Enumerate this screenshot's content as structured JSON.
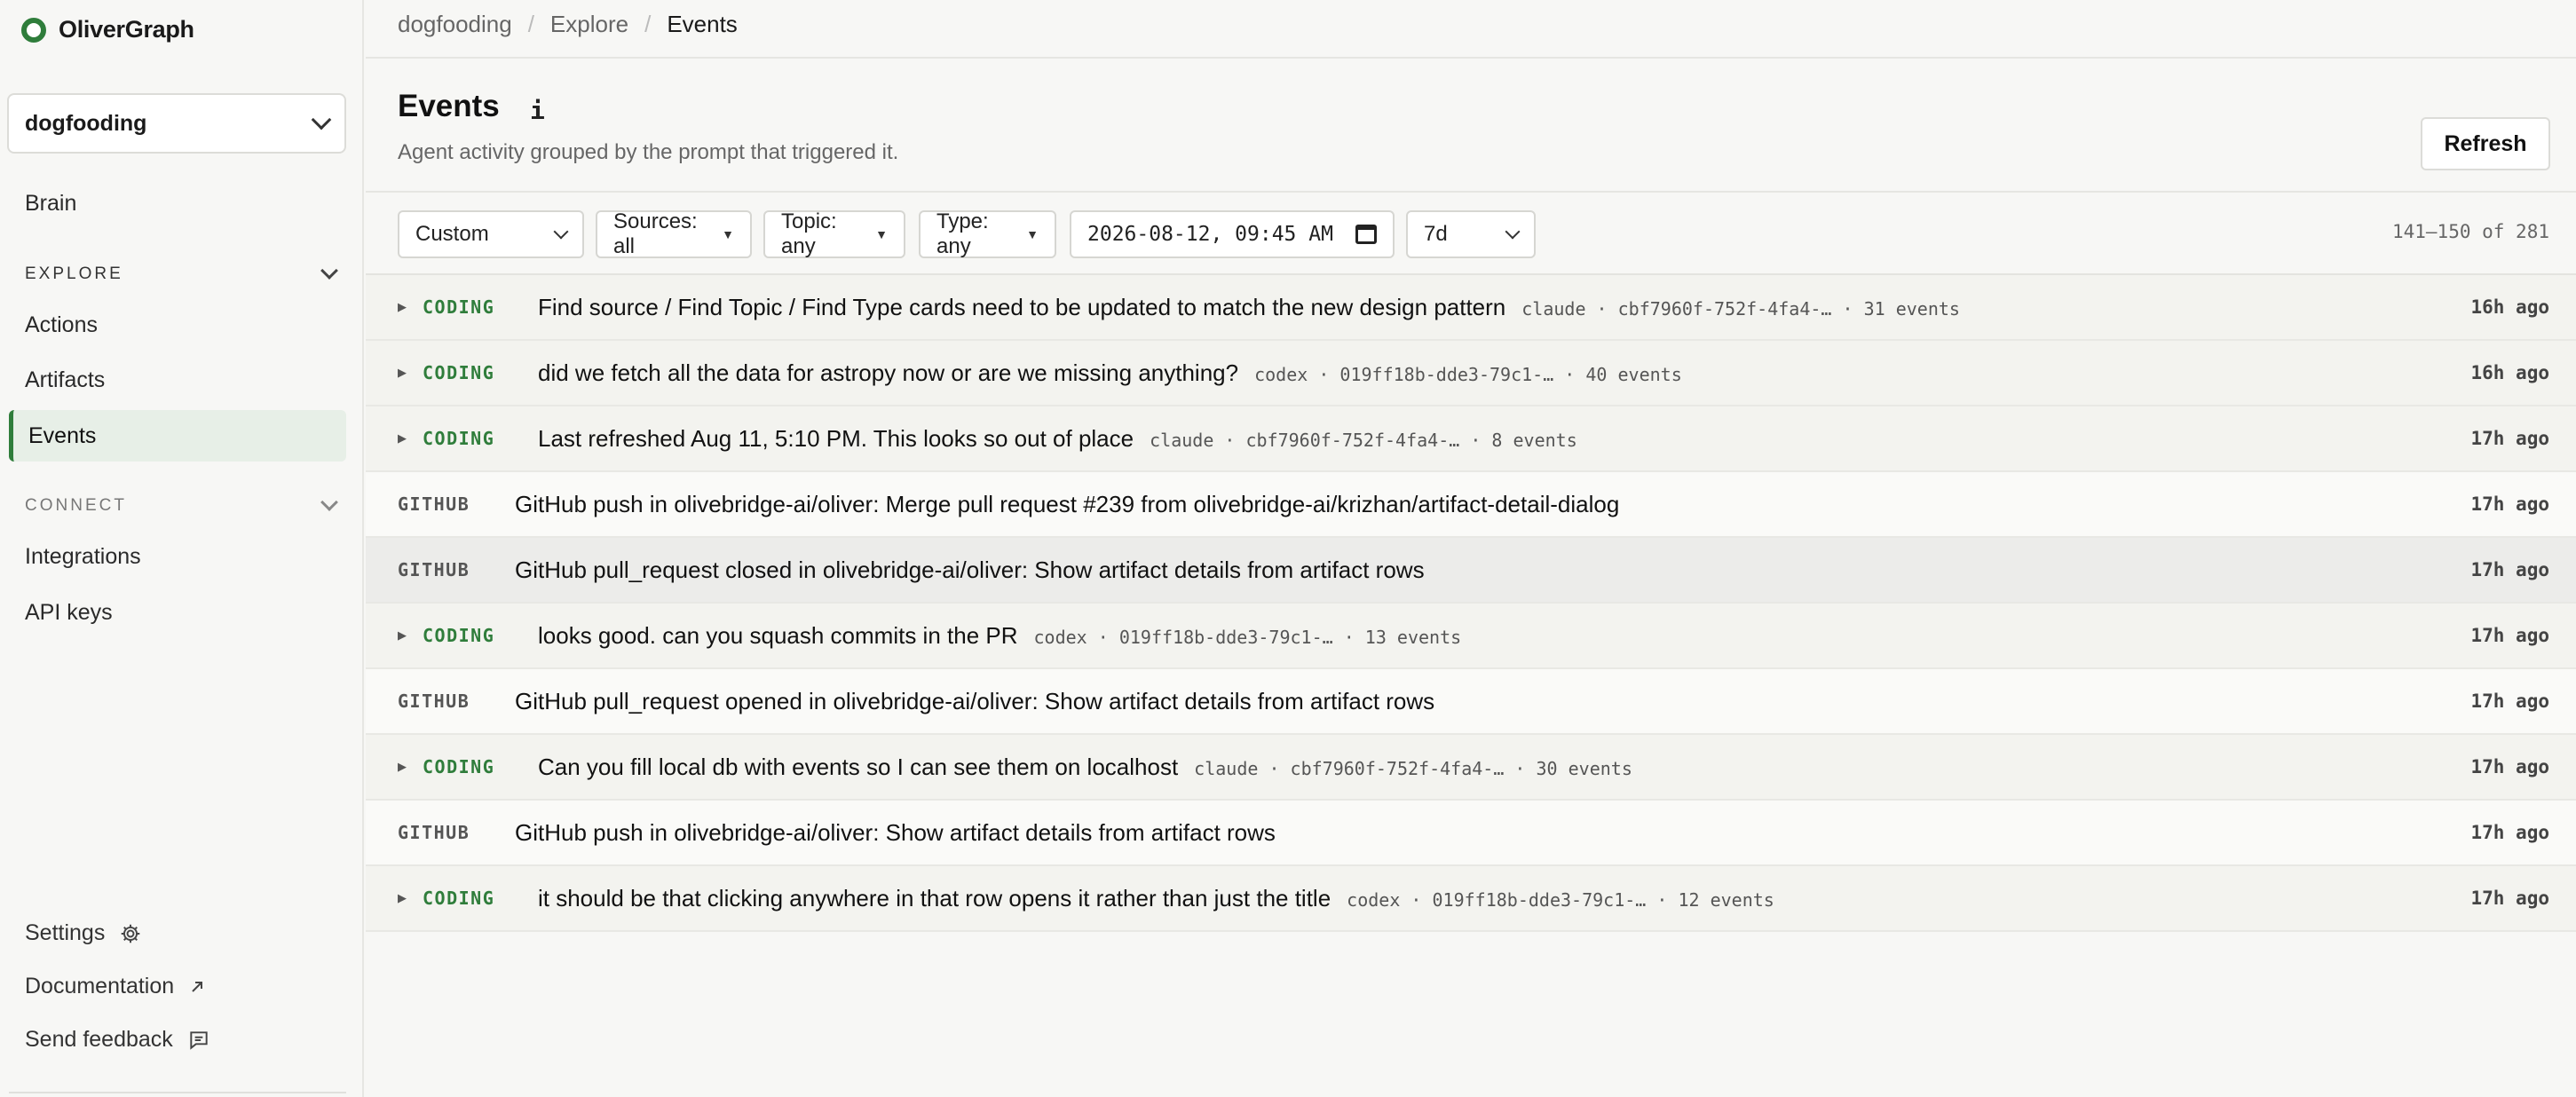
{
  "app": {
    "name": "OliverGraph"
  },
  "sidebar": {
    "project": "dogfooding",
    "brain_label": "Brain",
    "explore": {
      "heading": "EXPLORE",
      "items": [
        "Actions",
        "Artifacts",
        "Events"
      ]
    },
    "connect": {
      "heading": "CONNECT",
      "items": [
        "Integrations",
        "API keys"
      ]
    },
    "footer": {
      "settings": "Settings",
      "documentation": "Documentation",
      "feedback": "Send feedback"
    }
  },
  "breadcrumb": [
    "dogfooding",
    "Explore",
    "Events"
  ],
  "page": {
    "title": "Events",
    "info": "i",
    "subtitle": "Agent activity grouped by the prompt that triggered it.",
    "refresh": "Refresh"
  },
  "filters": {
    "range_preset": "Custom",
    "sources": "Sources: all",
    "topic": "Topic: any",
    "type": "Type: any",
    "datetime": "2026-08-12, 09:45 AM",
    "window": "7d",
    "pagination": "141–150 of 281"
  },
  "rows": [
    {
      "kind": "coding",
      "tag": "CODING",
      "message": "Find source / Find Topic / Find Type cards need to be updated to match the new design pattern",
      "meta": "claude · cbf7960f-752f-4fa4-… · 31 events",
      "time": "16h ago"
    },
    {
      "kind": "coding",
      "tag": "CODING",
      "message": "did we fetch all the data for astropy now or are we missing anything?",
      "meta": "codex · 019ff18b-dde3-79c1-… · 40 events",
      "time": "16h ago"
    },
    {
      "kind": "coding",
      "tag": "CODING",
      "message": "Last refreshed Aug 11, 5:10 PM. This looks so out of place",
      "meta": "claude · cbf7960f-752f-4fa4-… · 8 events",
      "time": "17h ago"
    },
    {
      "kind": "github",
      "tag": "GITHUB",
      "message": "GitHub push in olivebridge-ai/oliver: Merge pull request #239 from olivebridge-ai/krizhan/artifact-detail-dialog",
      "meta": "",
      "time": "17h ago"
    },
    {
      "kind": "github",
      "tag": "GITHUB",
      "message": "GitHub pull_request closed in olivebridge-ai/oliver: Show artifact details from artifact rows",
      "meta": "",
      "time": "17h ago"
    },
    {
      "kind": "coding",
      "tag": "CODING",
      "message": "looks good. can you squash commits in the PR",
      "meta": "codex · 019ff18b-dde3-79c1-… · 13 events",
      "time": "17h ago"
    },
    {
      "kind": "github",
      "tag": "GITHUB",
      "message": "GitHub pull_request opened in olivebridge-ai/oliver: Show artifact details from artifact rows",
      "meta": "",
      "time": "17h ago"
    },
    {
      "kind": "coding",
      "tag": "CODING",
      "message": "Can you fill local db with events so I can see them on localhost",
      "meta": "claude · cbf7960f-752f-4fa4-… · 30 events",
      "time": "17h ago"
    },
    {
      "kind": "github",
      "tag": "GITHUB",
      "message": "GitHub push in olivebridge-ai/oliver: Show artifact details from artifact rows",
      "meta": "",
      "time": "17h ago"
    },
    {
      "kind": "coding",
      "tag": "CODING",
      "message": "it should be that clicking anywhere in that row opens it rather than just the title",
      "meta": "codex · 019ff18b-dde3-79c1-… · 12 events",
      "time": "17h ago"
    }
  ],
  "colors": {
    "accent": "#2f7d3b",
    "background": "#f7f7f5"
  }
}
